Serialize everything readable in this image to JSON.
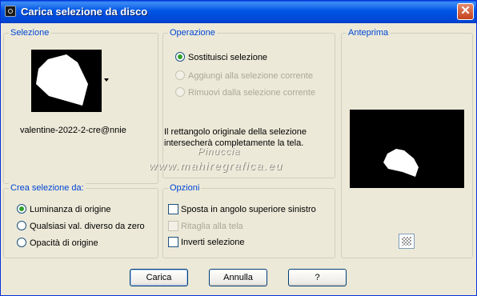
{
  "window": {
    "title": "Carica selezione da disco",
    "close_label": "✕"
  },
  "selezione": {
    "legend": "Selezione",
    "filename": "valentine-2022-2-cre@nnie"
  },
  "operazione": {
    "legend": "Operazione",
    "options": [
      {
        "label": "Sostituisci selezione",
        "checked": true,
        "enabled": true
      },
      {
        "label": "Aggiungi alla selezione corrente",
        "checked": false,
        "enabled": false
      },
      {
        "label": "Rimuovi dalla selezione corrente",
        "checked": false,
        "enabled": false
      }
    ],
    "info_line1": "Il rettangolo originale della selezione",
    "info_line2": "intersecherà completamente la tela."
  },
  "anteprima": {
    "legend": "Anteprima"
  },
  "crea": {
    "legend": "Crea selezione da:",
    "options": [
      {
        "label": "Luminanza di origine",
        "checked": true
      },
      {
        "label": "Qualsiasi val. diverso da zero",
        "checked": false
      },
      {
        "label": "Opacità di origine",
        "checked": false
      }
    ]
  },
  "opzioni": {
    "legend": "Opzioni",
    "items": [
      {
        "label": "Sposta in angolo superiore sinistro",
        "checked": false,
        "enabled": true
      },
      {
        "label": "Ritaglia alla tela",
        "checked": false,
        "enabled": false
      },
      {
        "label": "Inverti selezione",
        "checked": false,
        "enabled": true
      }
    ]
  },
  "watermark": {
    "line1": "Pinuccia",
    "line2": "www.mahiregrafica.eu"
  },
  "buttons": {
    "load": "Carica",
    "cancel": "Annulla",
    "help": "?"
  },
  "colors": {
    "title_bar": "#0055e5",
    "legend": "#0046d5",
    "dialog_bg": "#ece9d8"
  }
}
